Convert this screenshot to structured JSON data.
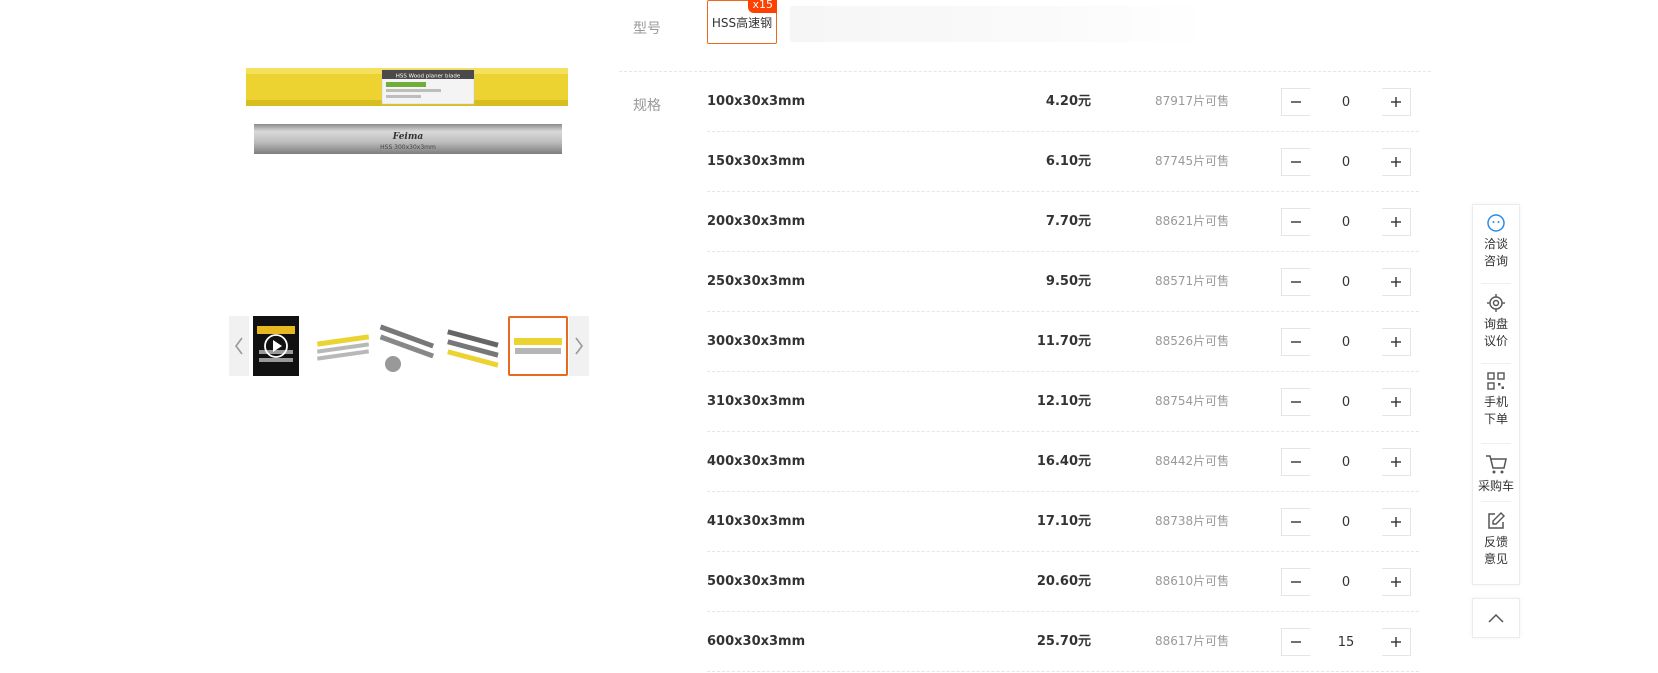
{
  "product": {
    "image_brand_text": "Feima",
    "image_blade_text": "HSS 300x30x3mm",
    "image_label_text": "HSS Wood planer blade"
  },
  "model": {
    "label": "型号",
    "option": "HSS高速钢",
    "badge": "x15"
  },
  "specs": {
    "label": "规格",
    "rows": [
      {
        "name": "100x30x3mm",
        "price": "4.20元",
        "stock": "87917片可售",
        "qty": "0"
      },
      {
        "name": "150x30x3mm",
        "price": "6.10元",
        "stock": "87745片可售",
        "qty": "0"
      },
      {
        "name": "200x30x3mm",
        "price": "7.70元",
        "stock": "88621片可售",
        "qty": "0"
      },
      {
        "name": "250x30x3mm",
        "price": "9.50元",
        "stock": "88571片可售",
        "qty": "0"
      },
      {
        "name": "300x30x3mm",
        "price": "11.70元",
        "stock": "88526片可售",
        "qty": "0"
      },
      {
        "name": "310x30x3mm",
        "price": "12.10元",
        "stock": "88754片可售",
        "qty": "0"
      },
      {
        "name": "400x30x3mm",
        "price": "16.40元",
        "stock": "88442片可售",
        "qty": "0"
      },
      {
        "name": "410x30x3mm",
        "price": "17.10元",
        "stock": "88738片可售",
        "qty": "0"
      },
      {
        "name": "500x30x3mm",
        "price": "20.60元",
        "stock": "88610片可售",
        "qty": "0"
      },
      {
        "name": "600x30x3mm",
        "price": "25.70元",
        "stock": "88617片可售",
        "qty": "15"
      }
    ]
  },
  "sidebar": {
    "items": [
      {
        "label_l1": "洽谈",
        "label_l2": "咨询",
        "icon": "chat-icon"
      },
      {
        "label_l1": "询盘",
        "label_l2": "议价",
        "icon": "target-icon"
      },
      {
        "label_l1": "手机",
        "label_l2": "下单",
        "icon": "qr-code-icon"
      },
      {
        "label_l1": "采购车",
        "label_l2": "",
        "icon": "cart-icon"
      },
      {
        "label_l1": "反馈",
        "label_l2": "意见",
        "icon": "edit-icon"
      }
    ],
    "back_to_top_icon": "chevron-up-icon"
  },
  "colors": {
    "accent": "#e86a1f",
    "badge": "#ff4000",
    "icon_blue": "#2a8ce5",
    "box_yellow": "#ecd331"
  }
}
